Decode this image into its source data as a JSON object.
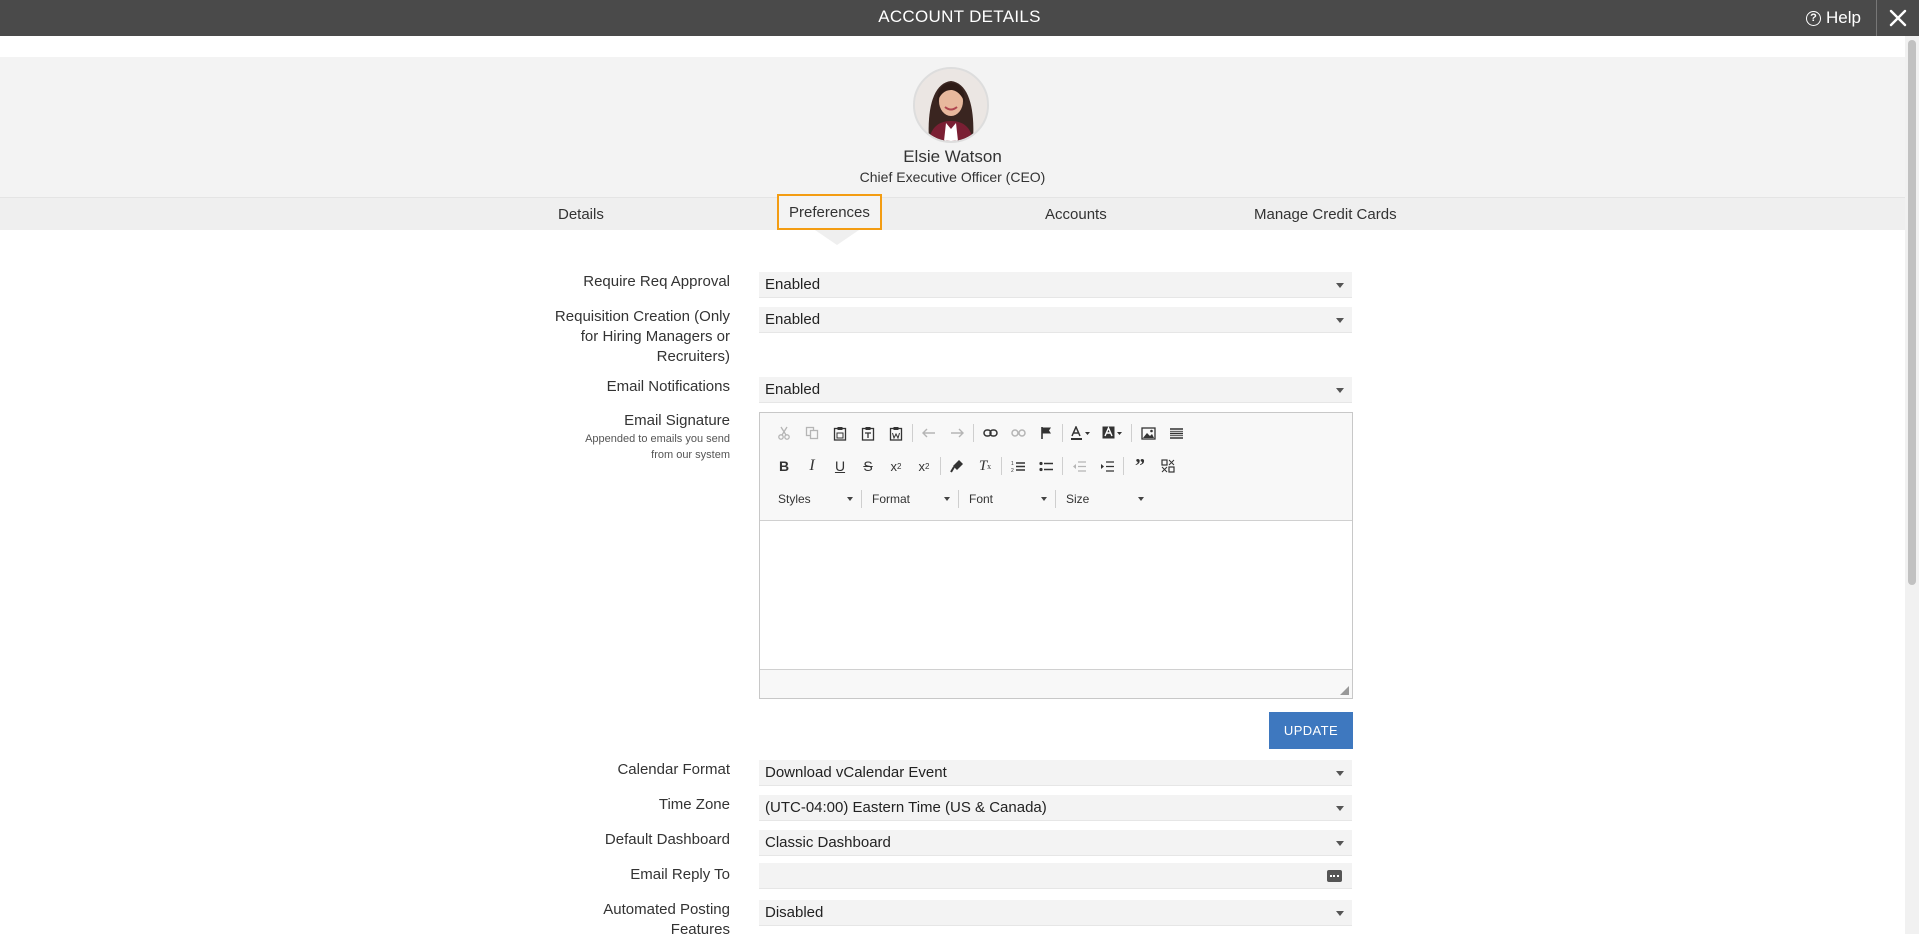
{
  "header": {
    "title": "ACCOUNT DETAILS",
    "help_label": "Help"
  },
  "profile": {
    "name": "Elsie Watson",
    "job_title": "Chief Executive Officer (CEO)"
  },
  "tabs": [
    {
      "label": "Details"
    },
    {
      "label": "Preferences",
      "active": true
    },
    {
      "label": "Accounts"
    },
    {
      "label": "Manage Credit Cards"
    }
  ],
  "preferences": {
    "require_req_approval": {
      "label": "Require Req Approval",
      "value": "Enabled"
    },
    "requisition_creation": {
      "label_lines": [
        "Requisition Creation (Only",
        "for Hiring Managers or",
        "Recruiters)"
      ],
      "value": "Enabled"
    },
    "email_notifications": {
      "label": "Email Notifications",
      "value": "Enabled"
    },
    "email_signature": {
      "label": "Email Signature",
      "sublabel_lines": [
        "Appended to emails you send",
        "from our system"
      ],
      "combos": [
        "Styles",
        "Format",
        "Font",
        "Size"
      ]
    },
    "update_label": "UPDATE",
    "calendar_format": {
      "label": "Calendar Format",
      "value": "Download vCalendar Event"
    },
    "time_zone": {
      "label": "Time Zone",
      "value": "(UTC-04:00) Eastern Time (US & Canada)"
    },
    "default_dashboard": {
      "label": "Default Dashboard",
      "value": "Classic Dashboard"
    },
    "email_reply_to": {
      "label": "Email Reply To",
      "value": ""
    },
    "automated_posting": {
      "label_lines": [
        "Automated Posting",
        "Features"
      ],
      "value": "Disabled"
    }
  },
  "colors": {
    "header_bg": "#4a4a4a",
    "active_tab_border": "#f39c12",
    "update_button": "#3e78bf"
  }
}
